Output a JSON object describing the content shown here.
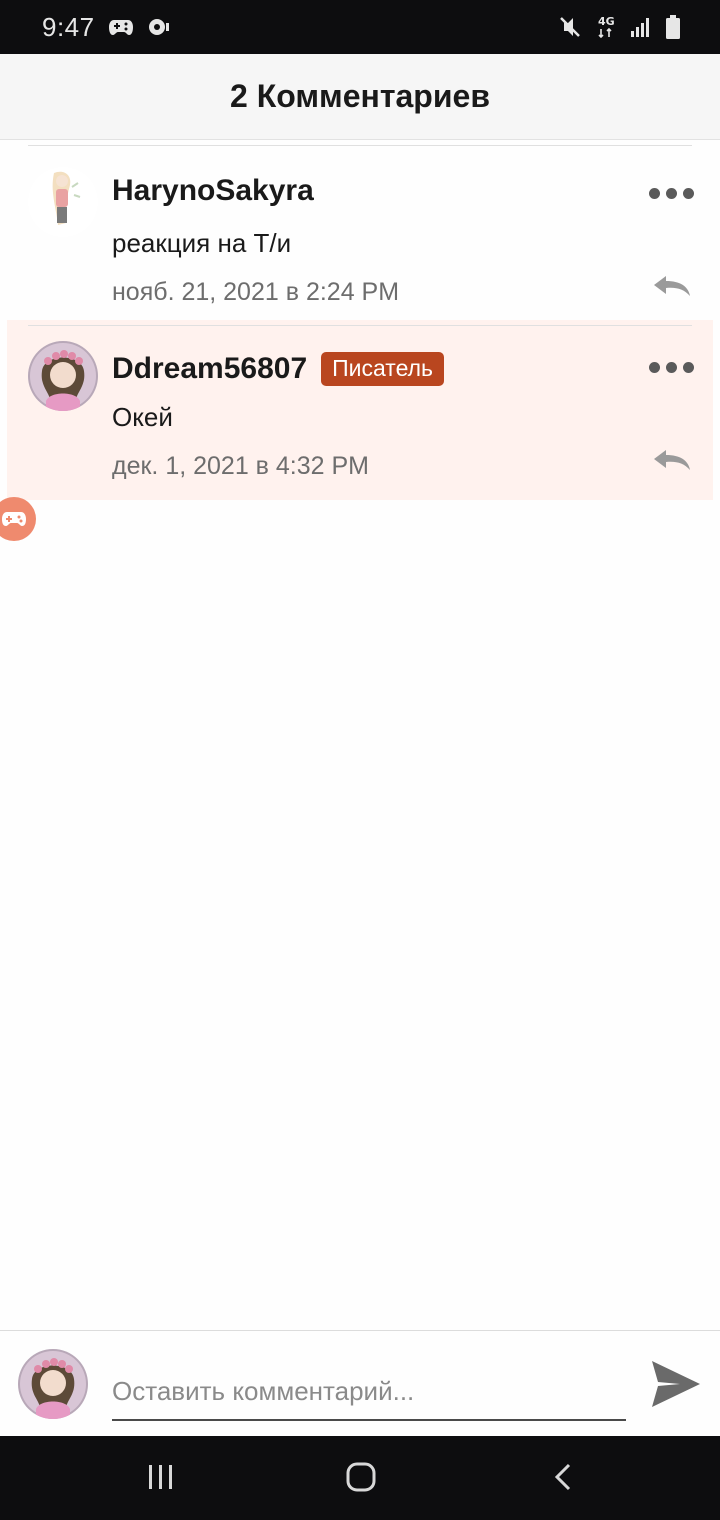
{
  "status_bar": {
    "time": "9:47",
    "network": "4G",
    "icons": [
      "gamepad-icon",
      "game-launcher-icon",
      "vibrate-mute-icon",
      "network-4g-icon",
      "signal-icon",
      "battery-icon"
    ]
  },
  "header": {
    "title": "2 Комментариев"
  },
  "comments": [
    {
      "username": "HarynoSakyra",
      "text": "реакция на Т/и",
      "time": "нояб. 21, 2021 в 2:24 PM",
      "badge": "",
      "highlighted": false
    },
    {
      "username": "Ddream56807",
      "text": "Окей",
      "time": "дек. 1, 2021 в 4:32 PM",
      "badge": "Писатель",
      "highlighted": true
    }
  ],
  "compose": {
    "placeholder": "Оставить комментарий..."
  },
  "colors": {
    "status_bar_bg": "#0d0d0f",
    "header_bg": "#f6f6f6",
    "highlight_bg": "#fff2ee",
    "badge_bg": "#b9461f",
    "game_bubble": "#ef8a6e"
  }
}
